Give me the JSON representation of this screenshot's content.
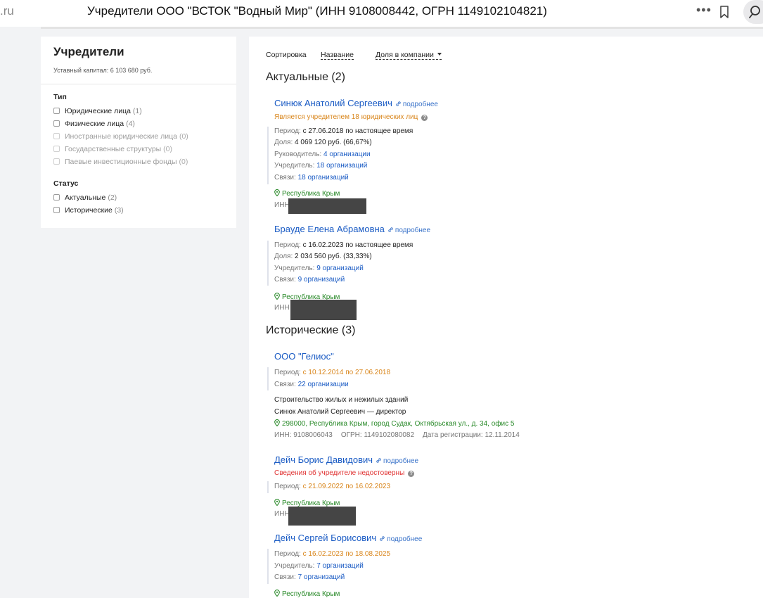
{
  "browser": {
    "url_fragment": ".ru",
    "title": "Учредители ООО \"ВСТОК \"Водный Мир\" (ИНН 9108008442, ОГРН 1149102104821)",
    "more_label": "•••"
  },
  "filters": {
    "title": "Учредители",
    "capital": "Уставный капитал: 6 103 680 руб.",
    "type_title": "Тип",
    "types": [
      {
        "label": "Юридические лица",
        "count": "(1)",
        "enabled": true
      },
      {
        "label": "Физические лица",
        "count": "(4)",
        "enabled": true
      },
      {
        "label": "Иностранные юридические лица",
        "count": "(0)",
        "enabled": false
      },
      {
        "label": "Государственные структуры",
        "count": "(0)",
        "enabled": false
      },
      {
        "label": "Паевые инвестиционные фонды",
        "count": "(0)",
        "enabled": false
      }
    ],
    "status_title": "Статус",
    "statuses": [
      {
        "label": "Актуальные",
        "count": "(2)",
        "enabled": true
      },
      {
        "label": "Исторические",
        "count": "(3)",
        "enabled": true
      }
    ]
  },
  "sort": {
    "label": "Сортировка",
    "by_name": "Название",
    "by_share": "Доля в компании"
  },
  "current": {
    "heading": "Актуальные (2)",
    "items": [
      {
        "name": "Синюк Анатолий Сергеевич",
        "more": "подробнее",
        "note": "Является учредителем 18 юридических лиц",
        "period_label": "Период:",
        "period_value": "с 27.06.2018 по настоящее время",
        "share_label": "Доля:",
        "share_value": "4 069 120 руб. (66,67%)",
        "head_label": "Руководитель:",
        "head_value": "4 организации",
        "founder_label": "Учредитель:",
        "founder_value": "18 организаций",
        "links_label": "Связи:",
        "links_value": "18 организаций",
        "region": "Республика Крым",
        "inn_label": "ИНН"
      },
      {
        "name": "Брауде Елена Абрамовна",
        "more": "подробнее",
        "period_label": "Период:",
        "period_value": "с 16.02.2023 по настоящее время",
        "share_label": "Доля:",
        "share_value": "2 034 560 руб. (33,33%)",
        "founder_label": "Учредитель:",
        "founder_value": "9 организаций",
        "links_label": "Связи:",
        "links_value": "9 организаций",
        "region": "Республика Крым",
        "inn_label": "ИНН"
      }
    ]
  },
  "historical": {
    "heading": "Исторические (3)",
    "items": [
      {
        "name": "ООО \"Гелиос\"",
        "period_label": "Период:",
        "period_value": "с 10.12.2014 по 27.06.2018",
        "links_label": "Связи:",
        "links_value": "22 организации",
        "activity": "Строительство жилых и нежилых зданий",
        "director": "Синюк Анатолий Сергеевич — директор",
        "address": "298000, Республика Крым, город Судак, Октябрьская ул., д. 34, офис 5",
        "inn": "ИНН: 9108006043",
        "ogrn": "ОГРН: 1149102080082",
        "reg_date": "Дата регистрации: 12.11.2014"
      },
      {
        "name": "Дейч Борис Давидович",
        "more": "подробнее",
        "note": "Сведения об учредителе недостоверны",
        "period_label": "Период:",
        "period_value": "с 21.09.2022 по 16.02.2023",
        "region": "Республика Крым",
        "inn_label": "ИНН"
      },
      {
        "name": "Дейч Сергей Борисович",
        "more": "подробнее",
        "period_label": "Период:",
        "period_value": "с 16.02.2023 по 18.08.2025",
        "founder_label": "Учредитель:",
        "founder_value": "7 организаций",
        "links_label": "Связи:",
        "links_value": "7 организаций",
        "region": "Республика Крым"
      }
    ]
  }
}
